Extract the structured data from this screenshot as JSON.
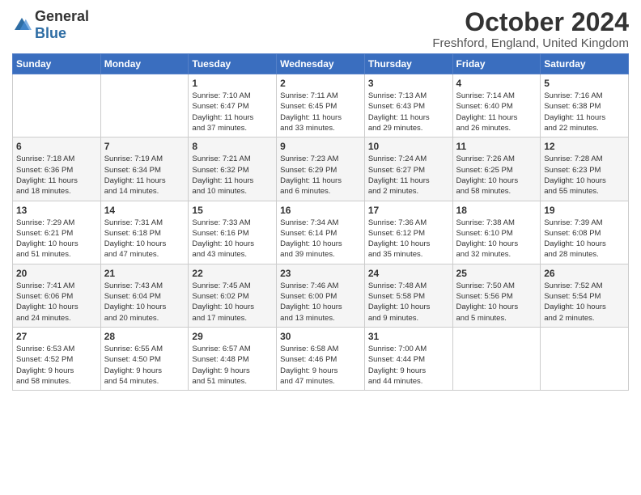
{
  "header": {
    "logo_general": "General",
    "logo_blue": "Blue",
    "title": "October 2024",
    "subtitle": "Freshford, England, United Kingdom"
  },
  "calendar": {
    "days_of_week": [
      "Sunday",
      "Monday",
      "Tuesday",
      "Wednesday",
      "Thursday",
      "Friday",
      "Saturday"
    ],
    "weeks": [
      [
        {
          "day": "",
          "detail": ""
        },
        {
          "day": "",
          "detail": ""
        },
        {
          "day": "1",
          "detail": "Sunrise: 7:10 AM\nSunset: 6:47 PM\nDaylight: 11 hours\nand 37 minutes."
        },
        {
          "day": "2",
          "detail": "Sunrise: 7:11 AM\nSunset: 6:45 PM\nDaylight: 11 hours\nand 33 minutes."
        },
        {
          "day": "3",
          "detail": "Sunrise: 7:13 AM\nSunset: 6:43 PM\nDaylight: 11 hours\nand 29 minutes."
        },
        {
          "day": "4",
          "detail": "Sunrise: 7:14 AM\nSunset: 6:40 PM\nDaylight: 11 hours\nand 26 minutes."
        },
        {
          "day": "5",
          "detail": "Sunrise: 7:16 AM\nSunset: 6:38 PM\nDaylight: 11 hours\nand 22 minutes."
        }
      ],
      [
        {
          "day": "6",
          "detail": "Sunrise: 7:18 AM\nSunset: 6:36 PM\nDaylight: 11 hours\nand 18 minutes."
        },
        {
          "day": "7",
          "detail": "Sunrise: 7:19 AM\nSunset: 6:34 PM\nDaylight: 11 hours\nand 14 minutes."
        },
        {
          "day": "8",
          "detail": "Sunrise: 7:21 AM\nSunset: 6:32 PM\nDaylight: 11 hours\nand 10 minutes."
        },
        {
          "day": "9",
          "detail": "Sunrise: 7:23 AM\nSunset: 6:29 PM\nDaylight: 11 hours\nand 6 minutes."
        },
        {
          "day": "10",
          "detail": "Sunrise: 7:24 AM\nSunset: 6:27 PM\nDaylight: 11 hours\nand 2 minutes."
        },
        {
          "day": "11",
          "detail": "Sunrise: 7:26 AM\nSunset: 6:25 PM\nDaylight: 10 hours\nand 58 minutes."
        },
        {
          "day": "12",
          "detail": "Sunrise: 7:28 AM\nSunset: 6:23 PM\nDaylight: 10 hours\nand 55 minutes."
        }
      ],
      [
        {
          "day": "13",
          "detail": "Sunrise: 7:29 AM\nSunset: 6:21 PM\nDaylight: 10 hours\nand 51 minutes."
        },
        {
          "day": "14",
          "detail": "Sunrise: 7:31 AM\nSunset: 6:18 PM\nDaylight: 10 hours\nand 47 minutes."
        },
        {
          "day": "15",
          "detail": "Sunrise: 7:33 AM\nSunset: 6:16 PM\nDaylight: 10 hours\nand 43 minutes."
        },
        {
          "day": "16",
          "detail": "Sunrise: 7:34 AM\nSunset: 6:14 PM\nDaylight: 10 hours\nand 39 minutes."
        },
        {
          "day": "17",
          "detail": "Sunrise: 7:36 AM\nSunset: 6:12 PM\nDaylight: 10 hours\nand 35 minutes."
        },
        {
          "day": "18",
          "detail": "Sunrise: 7:38 AM\nSunset: 6:10 PM\nDaylight: 10 hours\nand 32 minutes."
        },
        {
          "day": "19",
          "detail": "Sunrise: 7:39 AM\nSunset: 6:08 PM\nDaylight: 10 hours\nand 28 minutes."
        }
      ],
      [
        {
          "day": "20",
          "detail": "Sunrise: 7:41 AM\nSunset: 6:06 PM\nDaylight: 10 hours\nand 24 minutes."
        },
        {
          "day": "21",
          "detail": "Sunrise: 7:43 AM\nSunset: 6:04 PM\nDaylight: 10 hours\nand 20 minutes."
        },
        {
          "day": "22",
          "detail": "Sunrise: 7:45 AM\nSunset: 6:02 PM\nDaylight: 10 hours\nand 17 minutes."
        },
        {
          "day": "23",
          "detail": "Sunrise: 7:46 AM\nSunset: 6:00 PM\nDaylight: 10 hours\nand 13 minutes."
        },
        {
          "day": "24",
          "detail": "Sunrise: 7:48 AM\nSunset: 5:58 PM\nDaylight: 10 hours\nand 9 minutes."
        },
        {
          "day": "25",
          "detail": "Sunrise: 7:50 AM\nSunset: 5:56 PM\nDaylight: 10 hours\nand 5 minutes."
        },
        {
          "day": "26",
          "detail": "Sunrise: 7:52 AM\nSunset: 5:54 PM\nDaylight: 10 hours\nand 2 minutes."
        }
      ],
      [
        {
          "day": "27",
          "detail": "Sunrise: 6:53 AM\nSunset: 4:52 PM\nDaylight: 9 hours\nand 58 minutes."
        },
        {
          "day": "28",
          "detail": "Sunrise: 6:55 AM\nSunset: 4:50 PM\nDaylight: 9 hours\nand 54 minutes."
        },
        {
          "day": "29",
          "detail": "Sunrise: 6:57 AM\nSunset: 4:48 PM\nDaylight: 9 hours\nand 51 minutes."
        },
        {
          "day": "30",
          "detail": "Sunrise: 6:58 AM\nSunset: 4:46 PM\nDaylight: 9 hours\nand 47 minutes."
        },
        {
          "day": "31",
          "detail": "Sunrise: 7:00 AM\nSunset: 4:44 PM\nDaylight: 9 hours\nand 44 minutes."
        },
        {
          "day": "",
          "detail": ""
        },
        {
          "day": "",
          "detail": ""
        }
      ]
    ]
  }
}
